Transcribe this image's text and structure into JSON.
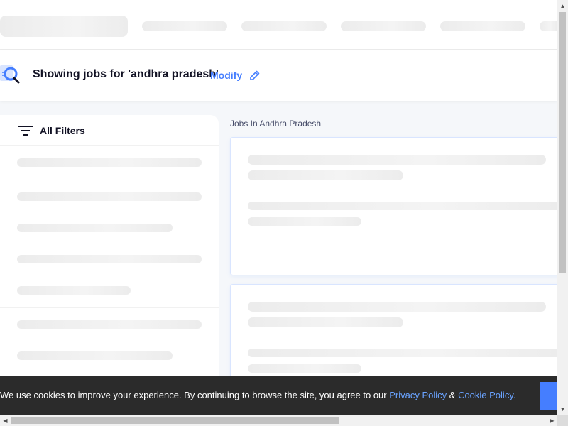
{
  "search_summary": {
    "title": "Showing jobs for 'andhra pradesh'",
    "modify_label": "Modify"
  },
  "filters": {
    "label": "All Filters"
  },
  "jobs": {
    "heading": "Jobs In Andhra Pradesh"
  },
  "cookie_banner": {
    "message": "We use cookies to improve your experience. By continuing to browse the site, you agree to our ",
    "privacy_label": "Privacy Policy",
    "separator": " & ",
    "cookie_label": "Cookie Policy."
  },
  "colors": {
    "accent": "#457eff",
    "banner_bg": "#2b2b2b",
    "skeleton": "#ececec"
  },
  "icons": [
    "search-icon",
    "pencil-icon",
    "filter-icon",
    "scroll-arrow-icons"
  ]
}
